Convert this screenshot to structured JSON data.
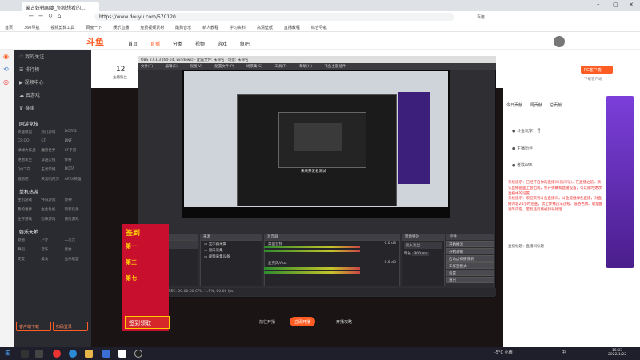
{
  "browser": {
    "tab_title": "蒙古妖韩国婆_你就想看的...",
    "url": "https://www.douyu.com/570120",
    "search_engine": "百度",
    "bookmarks": [
      "首页",
      "360导航",
      "视频剪辑工具",
      "百度一下",
      "娱乐直播",
      "免费视频素材",
      "酷狗音乐",
      "新人教程",
      "学习资料",
      "高清壁纸",
      "直播教程",
      "综合导航"
    ]
  },
  "site": {
    "logo": "斗鱼",
    "nav": [
      "首页",
      "直播",
      "分类",
      "视频",
      "游戏",
      "鱼吧"
    ],
    "active_nav": "直播",
    "room_number_label": "12",
    "room_sub": "主播粉丝"
  },
  "sidebar": {
    "items": [
      {
        "label": "我的关注"
      },
      {
        "label": "排行榜"
      },
      {
        "label": "视频中心"
      },
      {
        "label": "云游戏"
      },
      {
        "label": "赛事"
      }
    ],
    "sections": [
      {
        "title": "网游竞技",
        "items": [
          "英雄联盟",
          "热门游戏",
          "DOTA2",
          "CS:GO",
          "CF",
          "DNF",
          "球球大作战",
          "魔兽世界",
          "CF手游",
          "绝地求生",
          "穿越火线",
          "传奇",
          "QQ飞车",
          "王者荣耀",
          "DOTA",
          "逃跑吧",
          "天涯明月刀",
          "APEX英雄"
        ]
      },
      {
        "title": "单机热游",
        "items": [
          "主机游戏",
          "怀旧游戏",
          "原神",
          "我的世界",
          "生化危机",
          "刺客信条",
          "生存游戏",
          "恐怖游戏",
          "冒险游戏"
        ]
      },
      {
        "title": "娱乐天地",
        "items": [
          "颜值",
          "户外",
          "二次元",
          "舞蹈",
          "音乐",
          "星秀",
          "交友",
          "美食",
          "鱼乐联盟"
        ]
      }
    ],
    "btn_open": "客户端下载",
    "btn_sign": "扫码登录"
  },
  "obs": {
    "title": "OBS 27.1.3 (64-bit, windows) - 配置文件: 未命名 - 场景: 未命名",
    "menu": [
      "文件(F)",
      "编辑(E)",
      "视图(V)",
      "配置文件(P)",
      "场景集(S)",
      "工具(T)",
      "帮助(H)",
      "飞鱼主题插件"
    ],
    "panels": {
      "scenes": "场景",
      "sources": "来源",
      "mixer": "混音器",
      "transitions": "转场特效",
      "controls": "控件"
    },
    "scene_item": "场景",
    "source_items": [
      "显示器采集",
      "窗口采集",
      "视频采集设备"
    ],
    "mixer_tracks": [
      {
        "name": "桌面音频",
        "db": "0.0 dB"
      },
      {
        "name": "麦克风/Aux",
        "db": "0.0 dB"
      }
    ],
    "transition_type": "淡入淡出",
    "transition_duration_label": "时长",
    "transition_duration": "300 ms",
    "controls": [
      "开始推流",
      "开始录制",
      "启动虚拟摄像机",
      "工作室模式",
      "设置",
      "退出"
    ],
    "status": "LIVE: 00:00:00    REC: 00:00:00    CPU: 1.9%, 60.00 fps",
    "preview_tag": "未来开发者测试"
  },
  "overlay": {
    "banner_text": "签到",
    "banner_lines": [
      "第一",
      "第三",
      "第七"
    ],
    "qiandao_label": "签到领取",
    "bottom_buttons": [
      "前往开播",
      "开播攻略",
      "立即开播"
    ]
  },
  "right": {
    "tabs": [
      "今日贡献",
      "周贡献",
      "总贡献"
    ],
    "ranks": [
      {
        "name": "斗鱼玩家一号"
      },
      {
        "name": "主播粉丝"
      },
      {
        "name": "老铁666"
      }
    ],
    "chat": [
      {
        "text": "系统提示：已经开启你的直播间(房间号)，在直播之前，默认直播画面上会出现，打开弹幕和直播设置，可以随时更改直播中的设置"
      },
      {
        "text": "系统提示：欢迎来到斗鱼直播间，斗鱼提倡绿色直播，对直播内容24小时巡查，禁止传播违法违规、低俗色情、吸烟酗酒等内容，若有违反将被封号处理"
      },
      {
        "text": "直播标题：直播间标题"
      }
    ],
    "pc_btn": "PC客户端",
    "download": "下载客户端"
  },
  "taskbar": {
    "weather": "-5°C 小雨",
    "lang": "中",
    "time": "16:03",
    "date": "2022/1/22"
  }
}
